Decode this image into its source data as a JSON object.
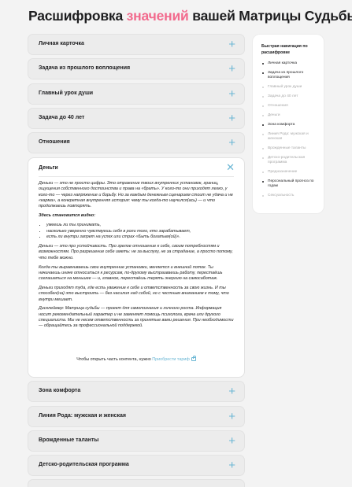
{
  "title": {
    "part1": "Расшифровка",
    "highlight": "значений",
    "part2": "вашей Матрицы Судьбы"
  },
  "accordion_top": [
    {
      "label": "Личная карточка"
    },
    {
      "label": "Задача из прошлого воплощения"
    },
    {
      "label": "Главный урок души"
    },
    {
      "label": "Задача до 40 лет"
    },
    {
      "label": "Отношения"
    }
  ],
  "open_section": {
    "title": "Деньги",
    "p1": "Деньги — это не просто цифры. Это отражение твоих внутренних установок, границ, ощущения собственного достоинства и права на «брать». У кого-то они приходят легко, у кого-то — через напряжение и борьбу. Но за каждым денежным сценарием стоит не удача и не «карма», а конкретная внутренняя история: чему ты когда-то научился(ась) — и что продолжаешь повторять.",
    "subheading": "Здесь становится видно:",
    "bullets": [
      "умеешь ли ты принимать,",
      "насколько уверенно чувствуешь себя в роли того, кто зарабатывает,",
      "есть ли внутри запрет на успех или страх «быть богатым(ой)»."
    ],
    "p2": "Деньги — это про устойчивость. Про зрелое отношение к себе, своим потребностям и возможностям. Про разрешение себе иметь: не за выслугу, не за страдание, а просто потому, что тебе можно.",
    "p3": "Когда ты выравниваешь свои внутренние установки, меняется и внешний поток. Ты начинаешь иначе относиться к ресурсам, по-другому выстраиваешь работу, перестаёшь соглашаться на меньшее — и, главное, перестаёшь терять энергию на самосаботаж.",
    "p4": "Деньги приходят туда, где есть уважение к себе и ответственность за свою жизнь. И ты способен(на) это выстроить — без насилия над собой, но с честным вниманием к тому, что внутри мешает.",
    "disclaimer": "Дисклеймер: Матрица судьбы — проект для самопознания и личного роста. Информация носит рекомендательный характер и не заменяет помощь психолога, врача или другого специалиста. Мы не несем ответственность за принятые вами решения. При необходимости — обращайтесь за профессиональной поддержкой.",
    "unlock_text": "Чтобы открыть часть контента, нужно",
    "unlock_link": "Приобрести тариф"
  },
  "accordion_bottom": [
    {
      "label": "Зона комфорта"
    },
    {
      "label": "Линия Рода: мужская и женская"
    },
    {
      "label": "Врожденные таланты"
    },
    {
      "label": "Детско-родительская программа"
    }
  ],
  "nav": {
    "title": "Быстрая навигация по расшифровке",
    "items": [
      {
        "label": "Личная карточка",
        "active": true
      },
      {
        "label": "Задача из прошлого воплощения",
        "active": true
      },
      {
        "label": "Главный урок души",
        "active": false
      },
      {
        "label": "Задача до 40 лет",
        "active": false
      },
      {
        "label": "Отношения",
        "active": false
      },
      {
        "label": "Деньги",
        "active": false
      },
      {
        "label": "Зона комфорта",
        "active": true
      },
      {
        "label": "Линия Рода: мужская и женская",
        "active": false
      },
      {
        "label": "Врожденные таланты",
        "active": false
      },
      {
        "label": "Детско-родительская программа",
        "active": false
      },
      {
        "label": "Предназначение",
        "active": false
      },
      {
        "label": "Персональный прогноз по годам",
        "active": true
      },
      {
        "label": "Сексуальность",
        "active": false
      }
    ]
  },
  "colors": {
    "accent": "#6ab6d4",
    "highlight": "#f26a8d"
  },
  "icons": {
    "expand": "plus-icon",
    "collapse": "close-icon",
    "lock": "lock-icon"
  }
}
